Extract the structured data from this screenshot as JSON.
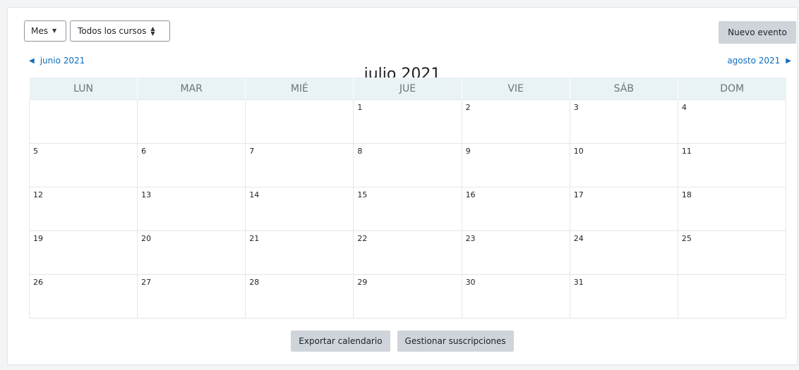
{
  "controls": {
    "view_select": "Mes",
    "course_select": "Todos los cursos",
    "new_event": "Nuevo evento"
  },
  "nav": {
    "prev_month": "junio 2021",
    "current_month": "julio 2021",
    "next_month": "agosto 2021"
  },
  "weekdays": [
    "LUN",
    "MAR",
    "MIÉ",
    "JUE",
    "VIE",
    "SÁB",
    "DOM"
  ],
  "weeks": [
    [
      "",
      "",
      "",
      "1",
      "2",
      "3",
      "4"
    ],
    [
      "5",
      "6",
      "7",
      "8",
      "9",
      "10",
      "11"
    ],
    [
      "12",
      "13",
      "14",
      "15",
      "16",
      "17",
      "18"
    ],
    [
      "19",
      "20",
      "21",
      "22",
      "23",
      "24",
      "25"
    ],
    [
      "26",
      "27",
      "28",
      "29",
      "30",
      "31",
      ""
    ]
  ],
  "footer": {
    "export": "Exportar calendario",
    "subscriptions": "Gestionar suscripciones"
  },
  "colors": {
    "link": "#0f6cbf",
    "header_bg": "#e9f2f4",
    "button_bg": "#ced4da"
  },
  "icons": {
    "view_caret": "caret-down-icon",
    "course_sort": "sort-updown-icon",
    "prev": "triangle-left-icon",
    "next": "triangle-right-icon"
  }
}
